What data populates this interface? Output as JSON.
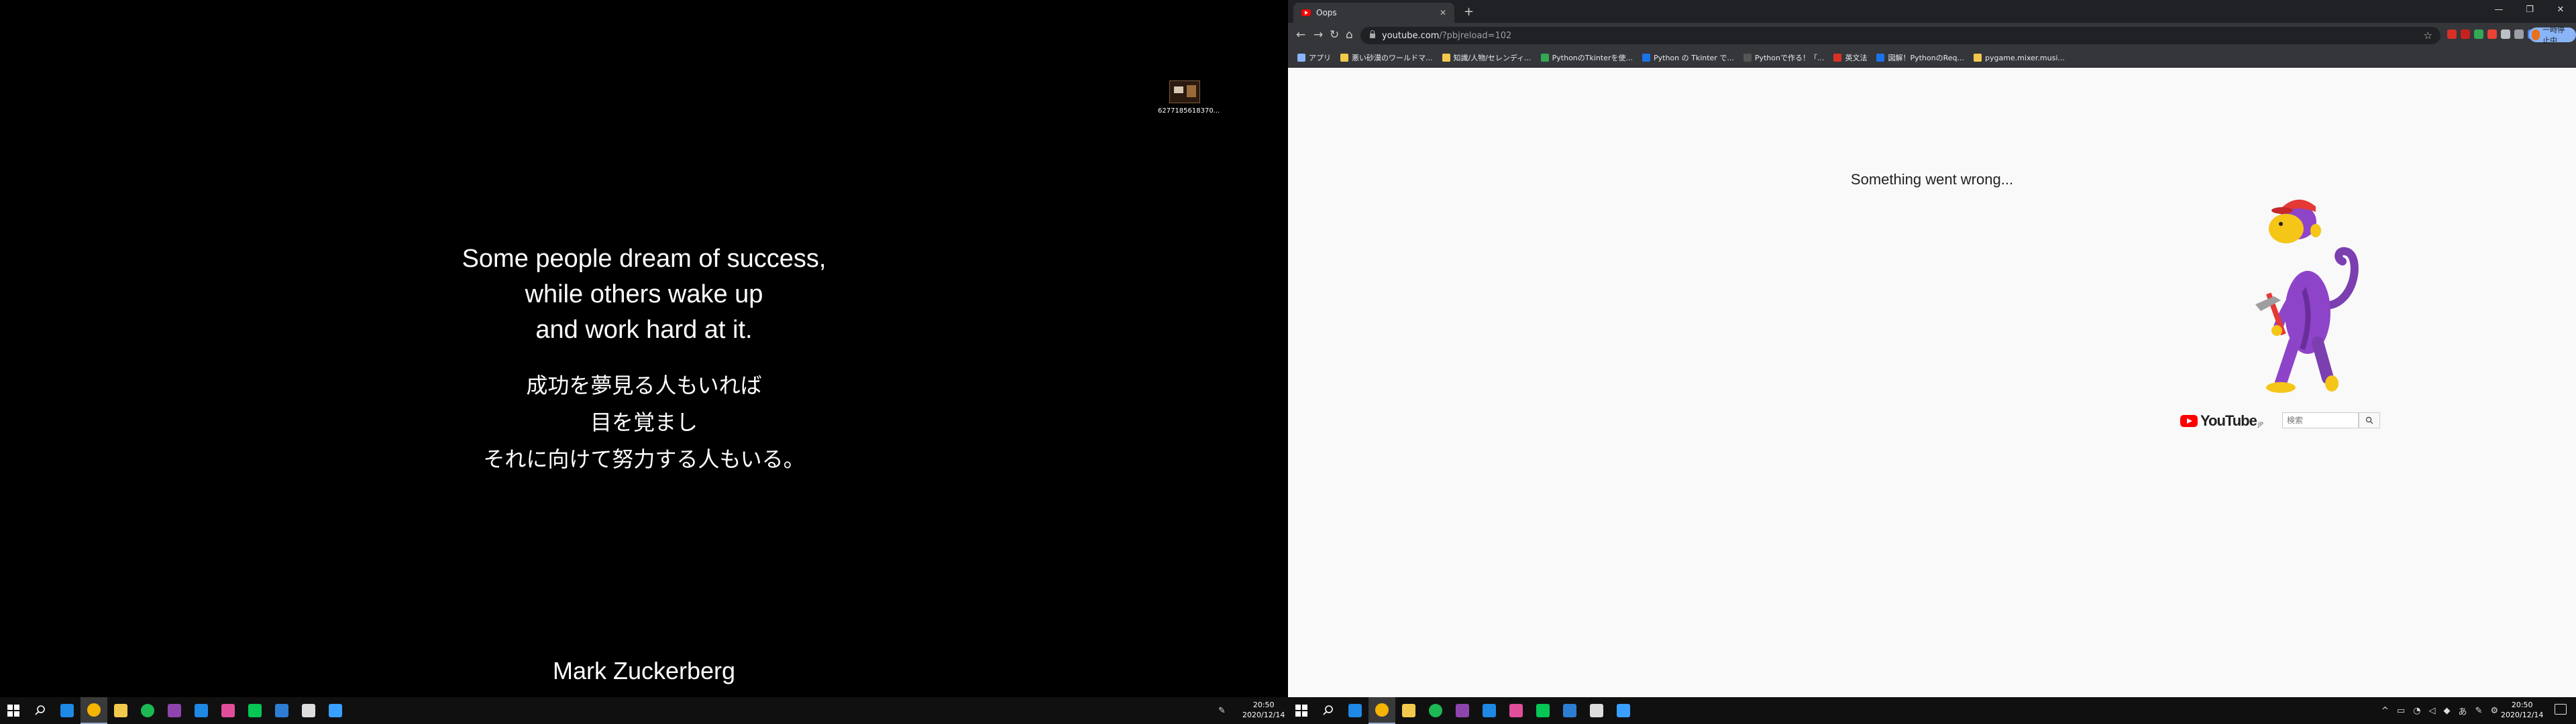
{
  "left_monitor": {
    "desktop_icon": {
      "label": "6277185618370...",
      "icon": "image-file-icon"
    },
    "quote_en": [
      "Some people dream of success,",
      "while others wake up",
      "and work hard at it."
    ],
    "quote_jp": [
      "成功を夢見る人もいれば",
      "目を覚まし",
      "それに向けて努力する人もいる。"
    ],
    "author": "Mark Zuckerberg",
    "clock": {
      "time": "20:50",
      "date": "2020/12/14"
    }
  },
  "browser": {
    "tab": {
      "title": "Oops",
      "close": "✕"
    },
    "new_tab": "+",
    "window_controls": [
      "—",
      "❐",
      "✕"
    ],
    "nav_icons": [
      "back-icon",
      "forward-icon",
      "reload-icon",
      "home-icon"
    ],
    "url": {
      "host": "youtube.com",
      "path": "/?pbjreload=102"
    },
    "profile": {
      "label": "一時停止中"
    },
    "bookmarks": [
      {
        "label": "アプリ",
        "color": "#8ab4f8"
      },
      {
        "label": "悪い砂漠のワールドマ...",
        "color": "#f2c94c"
      },
      {
        "label": "知識/人物/セレンディ...",
        "color": "#f2c94c"
      },
      {
        "label": "PythonのTkinterを使...",
        "color": "#34a853"
      },
      {
        "label": "Python の Tkinter で...",
        "color": "#1a73e8"
      },
      {
        "label": "Pythonで作る！「...",
        "color": "#555555"
      },
      {
        "label": "英文法",
        "color": "#d93025"
      },
      {
        "label": "図解！PythonのReq...",
        "color": "#1a73e8"
      },
      {
        "label": "pygame.mixer.musi...",
        "color": "#f2c94c"
      }
    ],
    "page": {
      "error_text": "Something went wrong...",
      "logo_word": "YouTube",
      "logo_region": "JP",
      "search_placeholder": "検索"
    }
  },
  "right_monitor": {
    "clock": {
      "time": "20:50",
      "date": "2020/12/14"
    }
  },
  "taskbar_apps": [
    {
      "name": "edge-icon",
      "color": "#1e88e5"
    },
    {
      "name": "chrome-icon",
      "color": "#f4b400",
      "active": true
    },
    {
      "name": "file-explorer-icon",
      "color": "#f2c94c"
    },
    {
      "name": "spotify-icon",
      "color": "#1db954"
    },
    {
      "name": "visual-studio-icon",
      "color": "#8e44ad"
    },
    {
      "name": "vscode-icon",
      "color": "#1e88e5"
    },
    {
      "name": "anaconda-icon",
      "color": "#e04e9a"
    },
    {
      "name": "line-icon",
      "color": "#06c755"
    },
    {
      "name": "mail-icon",
      "color": "#2d7dd2"
    },
    {
      "name": "cloud-app-icon",
      "color": "#dddddd"
    },
    {
      "name": "app-window-icon",
      "color": "#3aa0ff"
    }
  ]
}
